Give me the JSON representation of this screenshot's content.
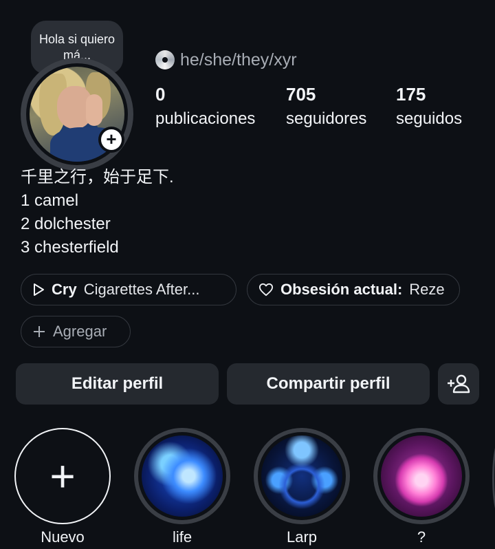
{
  "note": {
    "text": "Hola si quiero má..."
  },
  "profile": {
    "pronouns": "he/she/they/xyr",
    "pronouns_icon": "cd-icon"
  },
  "stats": [
    {
      "value": "0",
      "label": "publicaciones"
    },
    {
      "value": "705",
      "label": "seguidores"
    },
    {
      "value": "175",
      "label": "seguidos"
    }
  ],
  "bio": [
    "千里之行，始于足下.",
    "1 camel",
    "2 dolchester",
    "3 chesterfield"
  ],
  "chips": {
    "music": {
      "icon": "play-icon",
      "song": "Cry",
      "artist": "Cigarettes After..."
    },
    "obsession": {
      "icon": "heart-icon",
      "label": "Obsesión actual:",
      "value": "Reze"
    },
    "add": {
      "icon": "plus-icon",
      "label": "Agregar"
    }
  },
  "buttons": {
    "edit": "Editar perfil",
    "share": "Compartir perfil",
    "discover_icon": "add-person-icon"
  },
  "highlights": [
    {
      "label": "Nuevo"
    },
    {
      "label": "life"
    },
    {
      "label": "Larp"
    },
    {
      "label": "?"
    }
  ],
  "colors": {
    "background": "#0d1015",
    "button": "#25292f",
    "muted_text": "#a8adb5"
  }
}
